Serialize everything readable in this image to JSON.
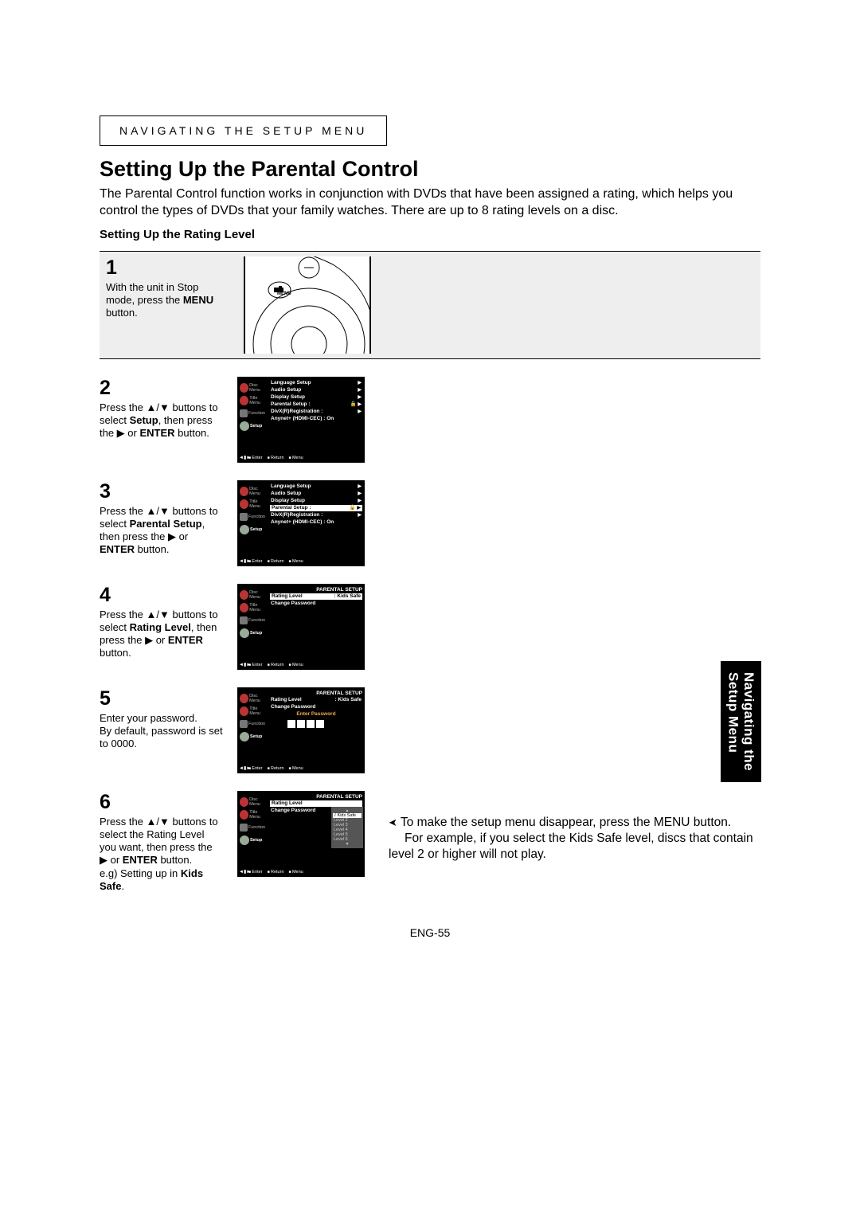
{
  "headerBox": "NAVIGATING THE SETUP MENU",
  "title": "Setting Up the Parental Control",
  "intro": "The Parental Control function works in conjunction with DVDs that have been assigned a rating, which helps you control the types of DVDs that your family watches. There are up to 8 rating levels on a disc.",
  "subhead": "Setting Up the Rating Level",
  "steps": {
    "s1": {
      "num": "1",
      "text_a": "With the unit in Stop mode, press the ",
      "text_b": "MENU",
      "text_c": " button."
    },
    "s2": {
      "num": "2",
      "text_a": "Press the ▲/▼ buttons to select ",
      "text_b": "Setup",
      "text_c": ", then press the ▶ or ",
      "text_d": "ENTER",
      "text_e": " button."
    },
    "s3": {
      "num": "3",
      "text_a": "Press the ▲/▼ buttons to select ",
      "text_b": "Parental Setup",
      "text_c": ", then press the ▶ or ",
      "text_d": "ENTER",
      "text_e": " button."
    },
    "s4": {
      "num": "4",
      "text_a": "Press the ▲/▼ buttons to select ",
      "text_b": "Rating Level",
      "text_c": ", then press the ▶ or ",
      "text_d": "ENTER",
      "text_e": " button."
    },
    "s5": {
      "num": "5",
      "text_a": "Enter your password.",
      "text_b": "By default, password is set to 0000."
    },
    "s6": {
      "num": "6",
      "text_a": "Press the ▲/▼ buttons to select the Rating Level you want, then press the ▶ or ",
      "text_b": "ENTER",
      "text_c": " button.",
      "text_d": "e.g) Setting up in ",
      "text_e": "Kids Safe",
      "text_f": "."
    }
  },
  "sideIcons": {
    "disc": "Disc Menu",
    "title": "Title Menu",
    "func": "Function",
    "setup": "Setup"
  },
  "menu": {
    "lang": "Language Setup",
    "audio": "Audio Setup",
    "display": "Display Setup",
    "parental": "Parental Setup :",
    "divx": "DivX(R)Registration :",
    "anynet": "Anynet+ (HDMI-CEC) : On"
  },
  "parentalScreen": {
    "header": "PARENTAL SETUP",
    "rating": "Rating Level",
    "ratingVal": ": Kids Safe",
    "change": "Change Password",
    "enterPw": "Enter Password"
  },
  "dropdown": {
    "kids": "√ Kids Safe",
    "l2": "Level 2",
    "l3": "Level 3",
    "l4": "Level 4",
    "l5": "Level 5",
    "l6": "Level 6"
  },
  "footer": {
    "enter": "Enter",
    "ret": "Return",
    "menu": "Menu"
  },
  "sideTab": {
    "line1": "Navigating the",
    "line2": "Setup Menu"
  },
  "footnote": {
    "line1": "To make the setup menu disappear, press the MENU button.",
    "line2": "For example, if you select the Kids Safe level, discs that contain level 2 or higher will not play."
  },
  "pageNum": "ENG-55",
  "menuLabel": "MENU"
}
